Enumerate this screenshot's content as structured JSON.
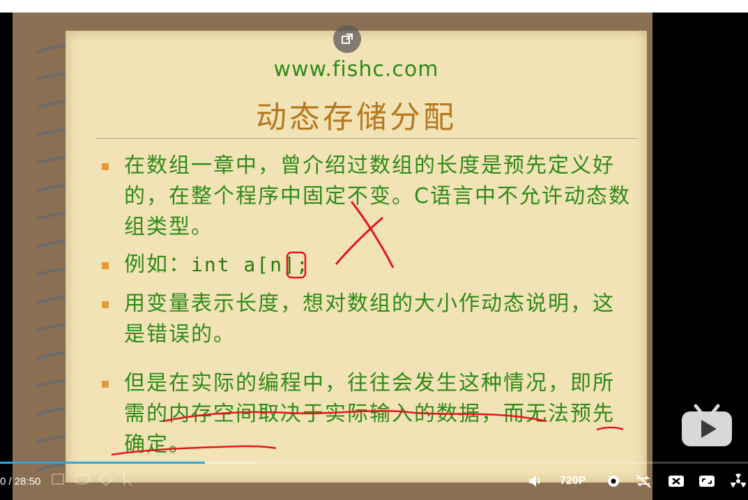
{
  "slide": {
    "site": "www.fishc.com",
    "title": "动态存储分配",
    "bullets": [
      {
        "text": "在数组一章中，曾介绍过数组的长度是预先定义好的，在整个程序中固定不变。C语言中不允许动态数组类型。"
      },
      {
        "prefix": "例如：",
        "code": "int a[n];"
      },
      {
        "text": "用变量表示长度，想对数组的大小作动态说明，这是错误的。"
      },
      {
        "text": "但是在实际的编程中，往往会发生这种情况，即所需的内存空间取决于实际输入的数据，而无法预先确定。"
      }
    ]
  },
  "player": {
    "time": "0 / 28:50",
    "quality": "720P",
    "progress_played": 0.274,
    "progress_buffered": 0.34,
    "icons": [
      "popout-icon",
      "play-icon",
      "volume-icon",
      "settings-icon",
      "loop-off-icon",
      "danmaku-icon",
      "fullscreen-icon",
      "radiation-icon"
    ]
  },
  "colors": {
    "slide_text": "#2f8a18",
    "title": "#b5781f",
    "progress": "#2aa8e0",
    "annotation": "#e5141b"
  }
}
